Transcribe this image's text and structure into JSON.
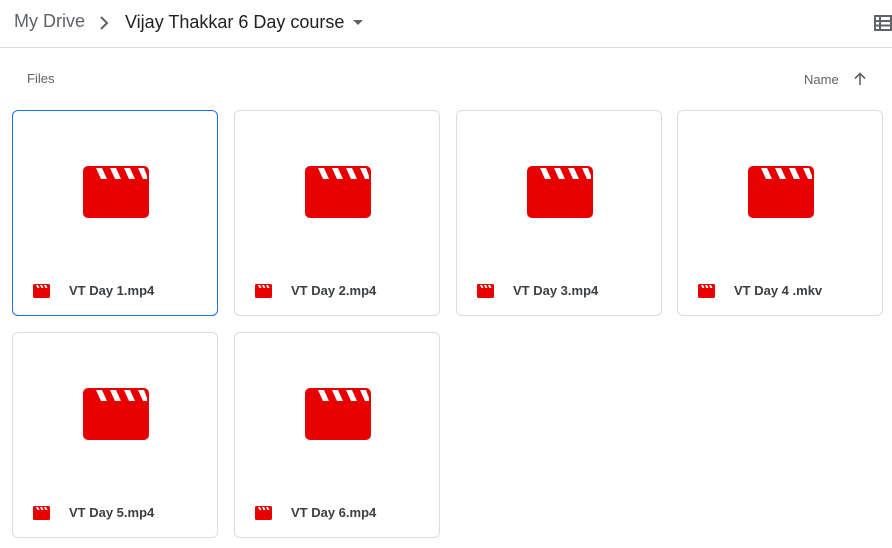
{
  "breadcrumb": {
    "root_label": "My Drive",
    "current_label": "Vijay Thakkar 6 Day course"
  },
  "header": {
    "view_toggle_icon": "list-view-icon"
  },
  "section": {
    "files_label": "Files",
    "sort_label": "Name",
    "sort_direction_icon": "arrow-up-icon"
  },
  "colors": {
    "video_red": "#e60000",
    "selected_border": "#1a73e8",
    "divider": "#dadce0"
  },
  "files": [
    {
      "name": "VT Day 1.mp4",
      "icon": "video-file-icon",
      "selected": true
    },
    {
      "name": "VT Day 2.mp4",
      "icon": "video-file-icon",
      "selected": false
    },
    {
      "name": "VT Day 3.mp4",
      "icon": "video-file-icon",
      "selected": false
    },
    {
      "name": "VT Day 4 .mkv",
      "icon": "video-file-icon",
      "selected": false
    },
    {
      "name": "VT Day 5.mp4",
      "icon": "video-file-icon",
      "selected": false
    },
    {
      "name": "VT Day 6.mp4",
      "icon": "video-file-icon",
      "selected": false
    }
  ]
}
